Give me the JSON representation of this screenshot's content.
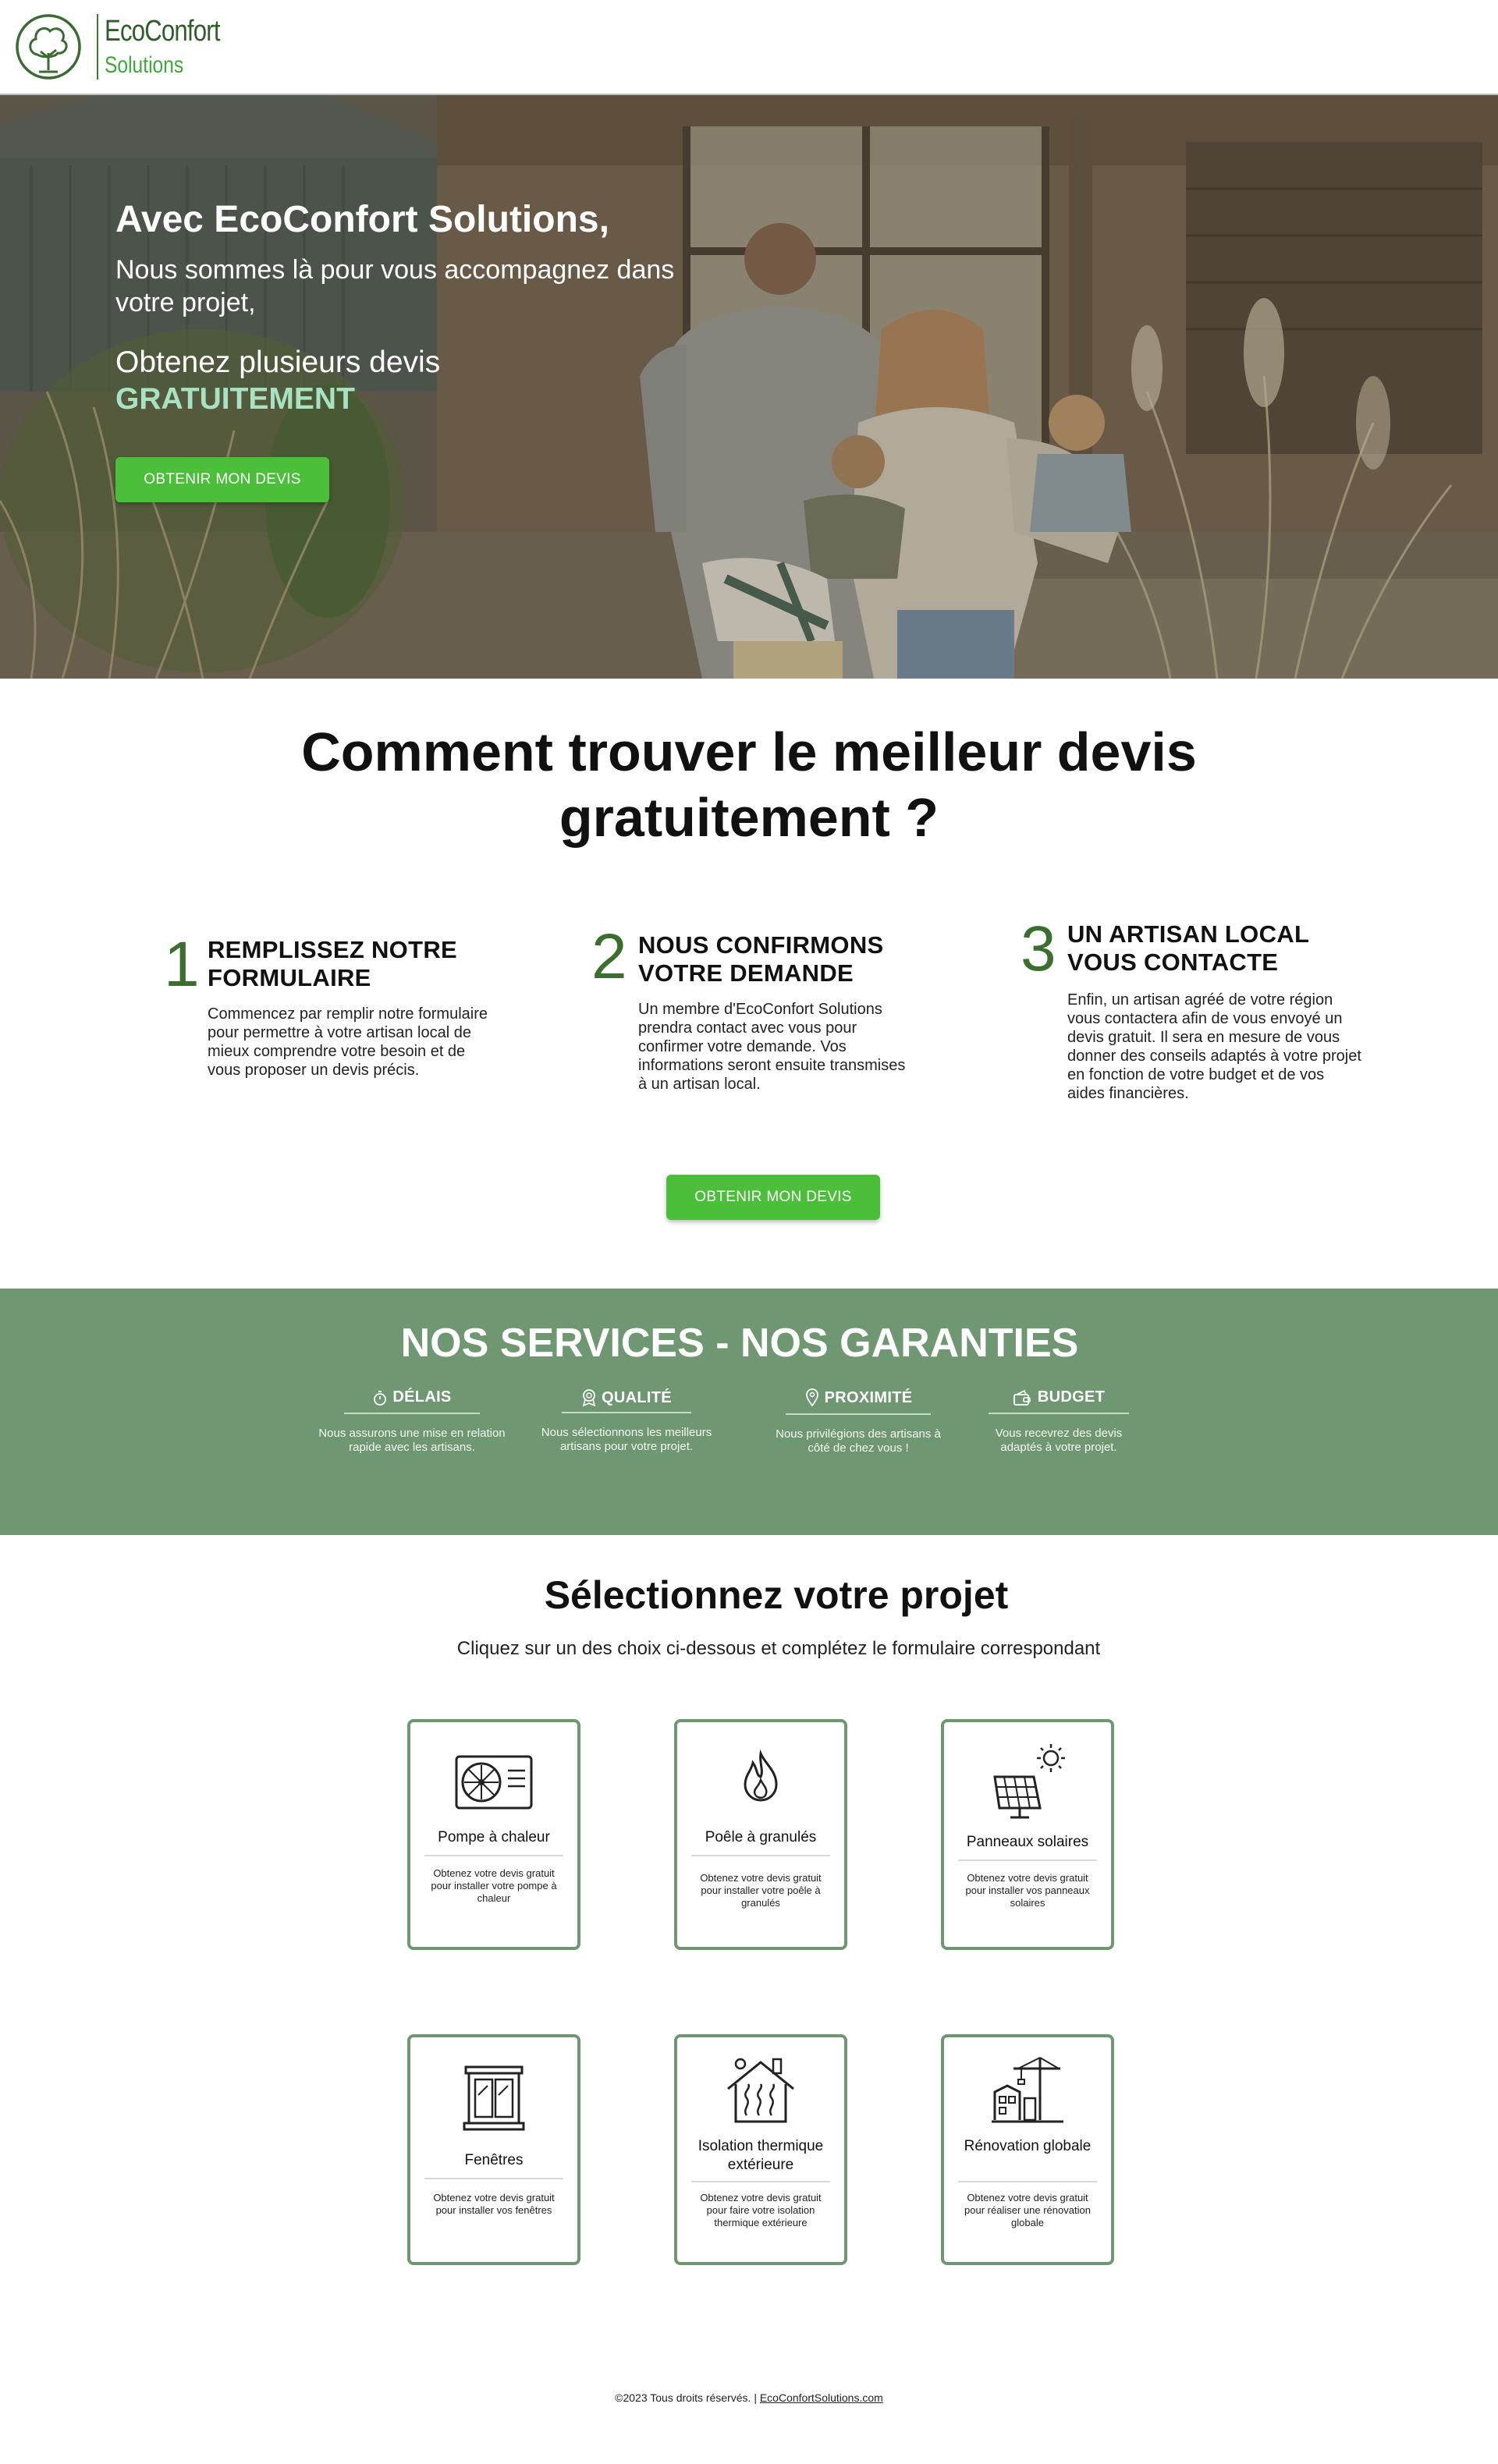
{
  "brand": {
    "name": "EcoConfort",
    "sub": "Solutions"
  },
  "hero": {
    "title": "Avec EcoConfort Solutions,",
    "subtitle": "Nous sommes là pour vous accompagnez dans votre projet,",
    "devis_line": "Obtenez plusieurs devis",
    "free": "GRATUITEMENT",
    "cta": "OBTENIR MON DEVIS"
  },
  "how": {
    "title": "Comment trouver le meilleur devis gratuitement ?",
    "steps": [
      {
        "num": "1",
        "head": "REMPLISSEZ NOTRE FORMULAIRE",
        "body": "Commencez par remplir notre formulaire pour permettre à votre artisan local de mieux comprendre votre besoin et de vous proposer un devis précis."
      },
      {
        "num": "2",
        "head": "NOUS CONFIRMONS VOTRE DEMANDE",
        "body": "Un membre d'EcoConfort Solutions prendra contact avec vous pour confirmer votre demande. Vos informations seront ensuite transmises à un artisan local."
      },
      {
        "num": "3",
        "head": "UN ARTISAN LOCAL VOUS CONTACTE",
        "body": "Enfin, un artisan agréé de votre région vous contactera afin de vous envoyé un devis gratuit. Il sera en mesure de vous donner des conseils adaptés à votre projet en fonction de votre budget et de vos aides financières."
      }
    ],
    "cta": "OBTENIR MON DEVIS"
  },
  "services": {
    "title": "NOS SERVICES - NOS GARANTIES",
    "items": [
      {
        "icon": "stopwatch-icon",
        "head": "DÉLAIS",
        "body": "Nous assurons une mise en relation rapide avec les artisans."
      },
      {
        "icon": "award-icon",
        "head": "QUALITÉ",
        "body": "Nous sélectionnons les meilleurs artisans pour votre projet."
      },
      {
        "icon": "location-pin-icon",
        "head": "PROXIMITÉ",
        "body": "Nous privilégions des artisans à côté de chez vous !"
      },
      {
        "icon": "wallet-icon",
        "head": "BUDGET",
        "body": "Vous recevrez des devis adaptés à votre projet."
      }
    ]
  },
  "select": {
    "title": "Sélectionnez votre projet",
    "subtitle": "Cliquez sur un des choix ci-dessous et complétez le formulaire correspondant",
    "cards": [
      {
        "icon": "heat-pump-icon",
        "label": "Pompe à chaleur",
        "desc": "Obtenez votre devis gratuit pour installer votre pompe à chaleur"
      },
      {
        "icon": "flame-icon",
        "label": "Poêle à granulés",
        "desc": "Obtenez votre devis gratuit pour installer votre poêle à granulés"
      },
      {
        "icon": "solar-panel-icon",
        "label": "Panneaux solaires",
        "desc": "Obtenez votre devis gratuit pour installer vos panneaux solaires"
      },
      {
        "icon": "window-icon",
        "label": "Fenêtres",
        "desc": "Obtenez votre devis gratuit pour installer vos fenêtres"
      },
      {
        "icon": "house-insulation-icon",
        "label": "Isolation thermique extérieure",
        "desc": "Obtenez votre devis gratuit pour faire votre isolation thermique extérieure"
      },
      {
        "icon": "renovation-crane-icon",
        "label": "Rénovation globale",
        "desc": "Obtenez votre devis gratuit pour réaliser une rénovation globale"
      }
    ]
  },
  "footer": {
    "copy": "©2023 Tous droits réservés. | ",
    "link": "EcoConfortSolutions.com"
  }
}
